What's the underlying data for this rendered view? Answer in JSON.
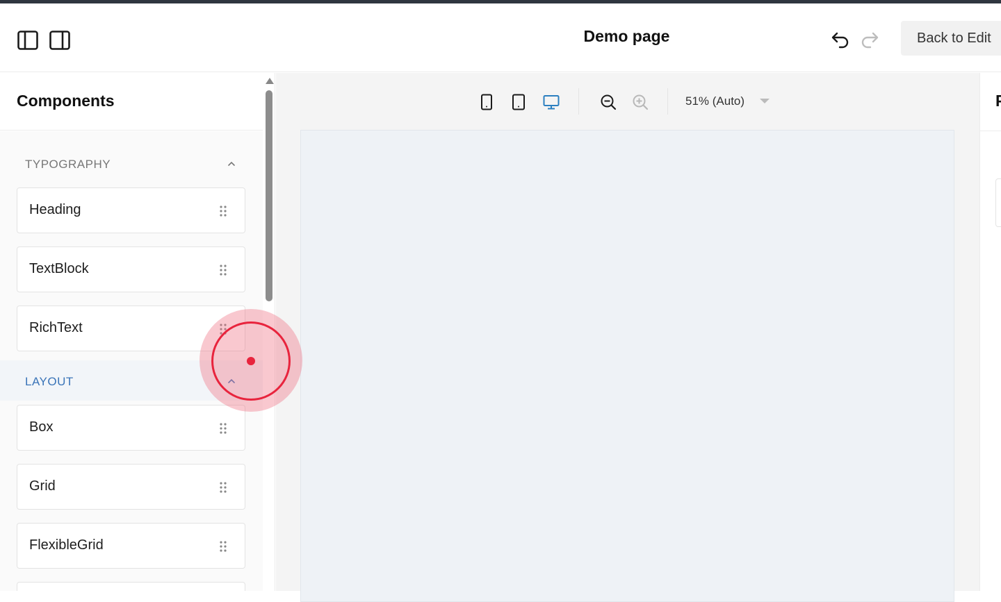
{
  "header": {
    "title": "Demo page",
    "back_label": "Back to Edit",
    "left_icons": [
      "left-panel-toggle-icon",
      "right-panel-toggle-icon"
    ],
    "undo_icon": "undo-icon",
    "redo_icon": "redo-icon"
  },
  "sidebar": {
    "title": "Components",
    "sections": [
      {
        "label": "TYPOGRAPHY",
        "expanded": true,
        "items": [
          "Heading",
          "TextBlock",
          "RichText"
        ]
      },
      {
        "label": "LAYOUT",
        "expanded": true,
        "items": [
          "Box",
          "Grid",
          "FlexibleGrid"
        ]
      }
    ]
  },
  "toolbar": {
    "device_icons": [
      "mobile-icon",
      "tablet-icon",
      "desktop-icon"
    ],
    "active_device": "desktop",
    "zoom_out_icon": "zoom-out-icon",
    "zoom_in_icon": "zoom-in-icon",
    "zoom_label": "51% (Auto)"
  },
  "right_panel": {
    "title_partial": "P"
  },
  "colors": {
    "accent": "#3a74b8",
    "active_device": "#2b7fc0",
    "canvas_frame": "#eef2f6",
    "click_marker": "#e8243d"
  }
}
